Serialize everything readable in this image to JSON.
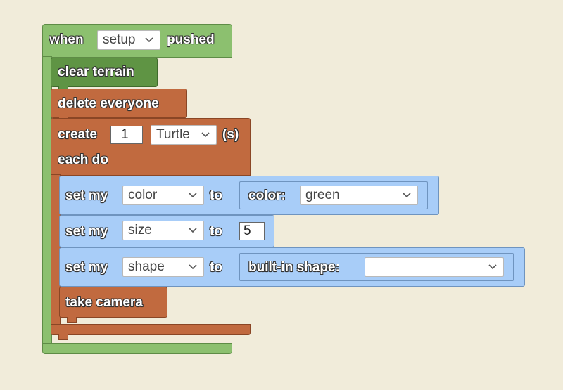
{
  "event_block": {
    "when_label": "when",
    "trigger_value": "setup",
    "pushed_label": "pushed"
  },
  "clear_terrain": {
    "label": "clear terrain"
  },
  "delete_everyone": {
    "label": "delete everyone"
  },
  "create_block": {
    "create_label": "create",
    "count_value": "1",
    "breed_value": "Turtle",
    "suffix_label": "(s)",
    "each_do_label": "each do"
  },
  "set_color": {
    "set_my_label": "set my",
    "property_value": "color",
    "to_label": "to",
    "color_label": "color:",
    "color_value": "green"
  },
  "set_size": {
    "set_my_label": "set my",
    "property_value": "size",
    "to_label": "to",
    "size_value": "5"
  },
  "set_shape": {
    "set_my_label": "set my",
    "property_value": "shape",
    "to_label": "to",
    "shape_label": "built-in shape:",
    "shape_value": ""
  },
  "take_camera": {
    "label": "take camera"
  },
  "colors": {
    "background": "#f1ecda",
    "event_green": "#8cc06f",
    "terrain_green": "#5f9444",
    "agent_brown": "#c16a3f",
    "property_blue": "#a8cdf8"
  }
}
